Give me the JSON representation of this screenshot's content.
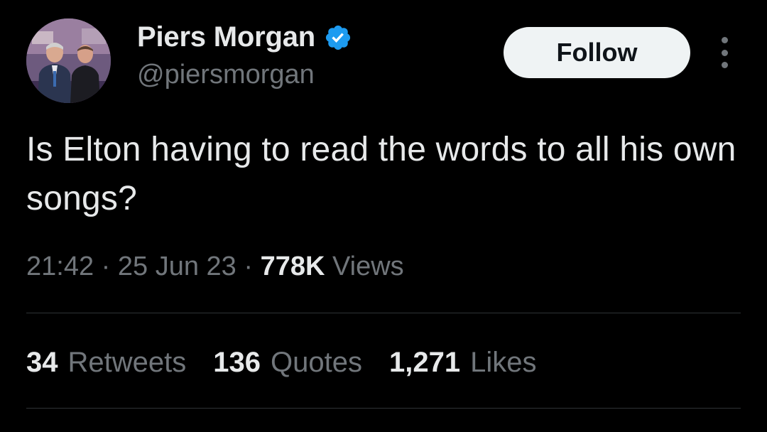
{
  "author": {
    "display_name": "Piers Morgan",
    "handle": "@piersmorgan",
    "verified_icon": "verified-badge-icon",
    "verified_color": "#1d9bf0",
    "avatar": "profile-photo"
  },
  "follow_button": {
    "label": "Follow"
  },
  "more_menu": {
    "icon": "more-vertical-icon"
  },
  "tweet": {
    "text": "Is Elton having to read the words to all his own songs?"
  },
  "meta": {
    "time": "21:42",
    "separator": "·",
    "date": "25 Jun 23",
    "views_count": "778K",
    "views_label": "Views"
  },
  "stats": {
    "retweets_count": "34",
    "retweets_label": "Retweets",
    "quotes_count": "136",
    "quotes_label": "Quotes",
    "likes_count": "1,271",
    "likes_label": "Likes"
  },
  "colors": {
    "background": "#000000",
    "primary_text": "#e7e9ea",
    "secondary_text": "#71767b",
    "divider": "#2f3336",
    "follow_bg": "#eff3f4"
  }
}
